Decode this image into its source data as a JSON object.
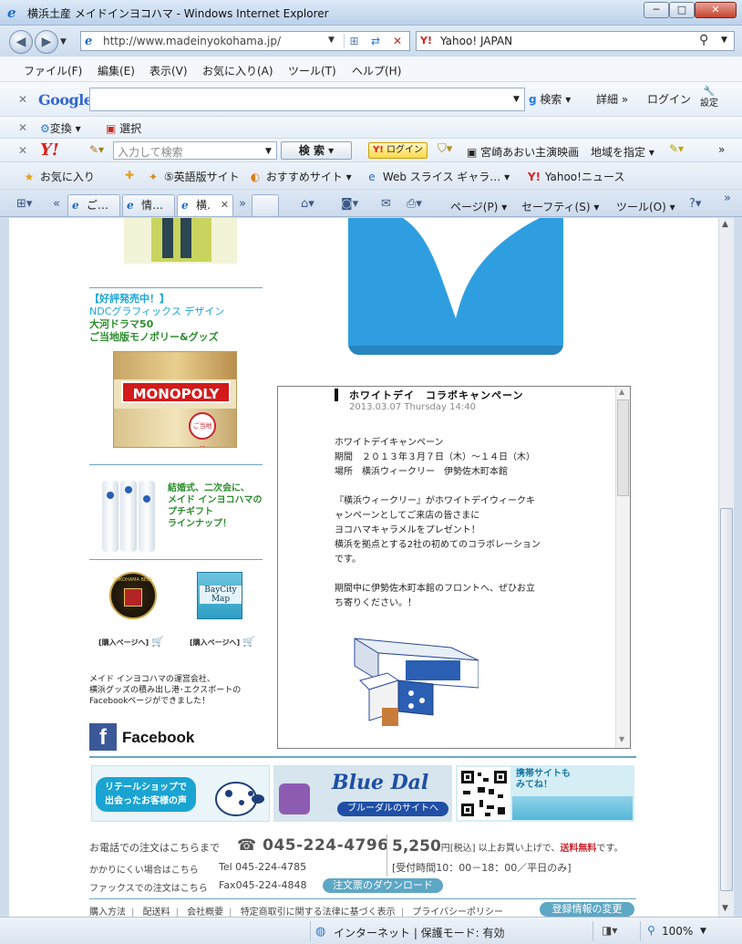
{
  "window": {
    "title": "横浜土産 メイドインヨコハマ - Windows Internet Explorer",
    "minimize": "─",
    "maximize": "□",
    "close": "✕"
  },
  "address": {
    "url": "http://www.madeinyokohama.jp/",
    "search_provider": "Yahoo! JAPAN"
  },
  "menu": [
    "ファイル(F)",
    "編集(E)",
    "表示(V)",
    "お気に入り(A)",
    "ツール(T)",
    "ヘルプ(H)"
  ],
  "google_bar": {
    "logo": "Google",
    "search_label": "検索",
    "details_label": "詳細",
    "login_label": "ログイン",
    "settings_label": "設定"
  },
  "convert_bar": {
    "convert_label": "変換",
    "select_label": "選択"
  },
  "yahoo_bar": {
    "logo": "Y!",
    "placeholder": "入力して検索",
    "search_button": "検 索",
    "login_label": "ログイン",
    "login_logo": "Y!",
    "movie_label": "宮崎あおい主演映画",
    "area_label": "地域を指定",
    "more": "»"
  },
  "favorites_bar": {
    "favorites_label": "お気に入り",
    "items": [
      "⑤英語版サイト",
      "おすすめサイト",
      "Web スライス ギャラ…",
      "Yahoo!ニュース"
    ]
  },
  "tabs": {
    "items": [
      "ご…",
      "情…",
      "横."
    ],
    "commands": [
      "ページ(P)",
      "セーフティ(S)",
      "ツール(O)"
    ]
  },
  "sidebar": {
    "promo_title": "【好評発売中！】",
    "promo_designer": "NDCグラフィックス デザイン",
    "promo_drama": "大河ドラマ50",
    "promo_product": "ご当地版モノポリー&グッズ",
    "monopoly_logo": "MONOPOLY",
    "monopoly_badge": "ご当地版",
    "wedding_text": "結婚式、二次会に、\nメイド インヨコハマの\nプチギフト\nラインナップ！",
    "beer_logo_text": "YOKOHAMA BEER",
    "baycity_text": "BayCity Map",
    "buy_page_label": "[購入ページへ]",
    "facebook_note": "メイド インヨコハマの運営会社、\n横浜グッズの積み出し港･エクスポートの\nFacebookページができました！",
    "facebook_label": "Facebook"
  },
  "blog": {
    "title": "ホワイトデイ　コラボキャンペーン",
    "date": "2013.03.07 Thursday 14:40",
    "body": "ホワイトデイキャンペーン\n期間　２０１３年３月７日（木）～１４日（木）\n場所　横浜ウィークリー　伊勢佐木町本館\n\n『横浜ウィークリー』がホワイトデイウィークキ\nャンペーンとしてご来店の皆さまに\nヨコハマキャラメルをプレゼント！\n横浜を拠点とする2社の初めてのコラボレーション\nです。\n\n期間中に伊勢佐木町本館のフロントへ、ぜひお立\nち寄りください。！"
  },
  "banners": {
    "retail": "リテールショップで\n出会ったお客様の声",
    "bluedal_title": "Blue Dal",
    "bluedal_sub": "ブルーダルのサイトへ",
    "mobile": "携帯サイトも\nみてね！"
  },
  "order": {
    "phone_label": "お電話での注文はこちらまで",
    "phone_number": "045-224-4796",
    "hard_label": "かかりにくい場合はこちら",
    "tel": "Tel 045-224-4785",
    "fax_label": "ファックスでの注文はこちら",
    "fax": "Fax045-224-4848",
    "download": "注文票のダウンロード",
    "amount": "5,250",
    "amount_unit": "円",
    "tax": "[税込]",
    "shipping_text": "以上お買い上げで、",
    "shipping_free": "送料無料",
    "shipping_end": "です。",
    "hours": "[受付時間10：00－18：00／平日のみ]"
  },
  "footer": {
    "links": [
      "購入方法",
      "配送料",
      "会社概要",
      "特定商取引に関する法律に基づく表示",
      "プライバシーポリシー"
    ],
    "register": "登録情報の変更"
  },
  "status": {
    "zone": "インターネット | 保護モード: 有効",
    "zoom": "100%"
  },
  "colors": {
    "accent_blue": "#1aa6d7",
    "accent_green": "#2c8d2e",
    "rule": "#6aa7c2",
    "button_blue": "#5ea7c4"
  }
}
